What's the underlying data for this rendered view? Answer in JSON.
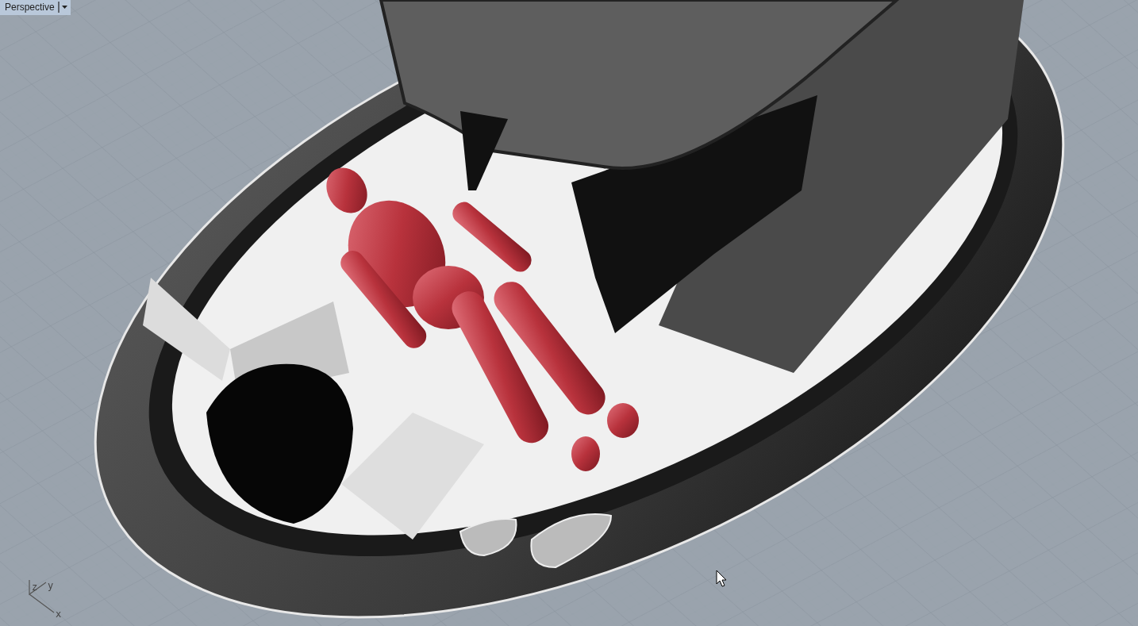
{
  "viewport": {
    "title": "Perspective",
    "axis_labels": [
      "z",
      "y",
      "x"
    ]
  }
}
